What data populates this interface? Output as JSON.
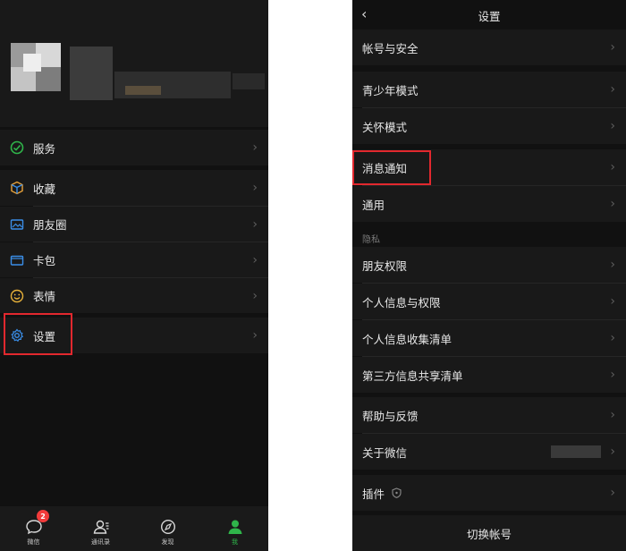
{
  "left": {
    "menu": {
      "service": "服务",
      "favorites": "收藏",
      "moments": "朋友圈",
      "cards": "卡包",
      "stickers": "表情",
      "settings": "设置"
    },
    "tabs": {
      "chats": "微信",
      "chats_badge": "2",
      "contacts": "通讯录",
      "discover": "发现",
      "me": "我"
    },
    "colors": {
      "accent": "#2fb54a",
      "highlight": "#e2282e",
      "badge": "#f23b3b"
    }
  },
  "right": {
    "nav": {
      "back": "‹",
      "title": "设置"
    },
    "items": {
      "account_security": "帐号与安全",
      "teen_mode": "青少年模式",
      "care_mode": "关怀模式",
      "notifications": "消息通知",
      "general": "通用",
      "privacy_header": "隐私",
      "friend_permissions": "朋友权限",
      "personal_info_permissions": "个人信息与权限",
      "personal_info_collection": "个人信息收集清单",
      "third_party_sharing": "第三方信息共享清单",
      "help_feedback": "帮助与反馈",
      "about_wechat": "关于微信",
      "plugins": "插件",
      "switch_account": "切换帐号"
    }
  },
  "chevron": "›"
}
